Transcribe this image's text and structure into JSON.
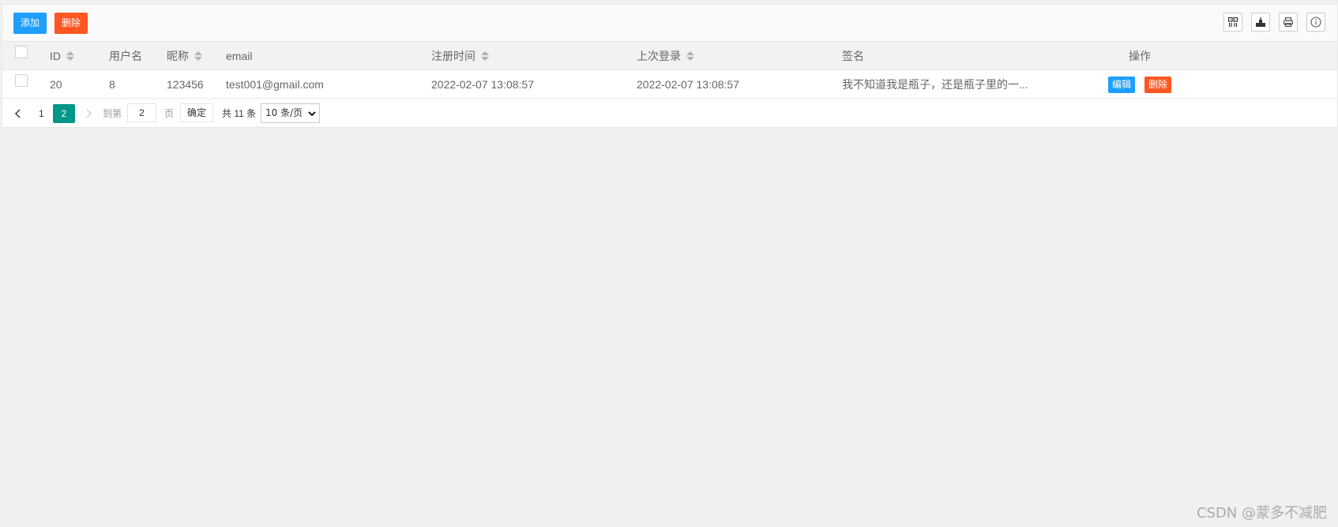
{
  "toolbar": {
    "add_label": "添加",
    "delete_label": "删除",
    "add_color": "#1e9fff",
    "delete_color": "#ff5722",
    "icons": [
      "columns-icon",
      "export-icon",
      "print-icon",
      "info-icon"
    ]
  },
  "table": {
    "headers": {
      "id": "ID",
      "username": "用户名",
      "nickname": "昵称",
      "email": "email",
      "register_time": "注册时间",
      "last_login": "上次登录",
      "signature": "签名",
      "actions": "操作"
    },
    "rows": [
      {
        "id": "20",
        "username": "8",
        "nickname": "123456",
        "email": "test001@gmail.com",
        "register_time": "2022-02-07 13:08:57",
        "last_login": "2022-02-07 13:08:57",
        "signature": "我不知道我是瓶子，还是瓶子里的一...",
        "edit_label": "编辑",
        "delete_label": "删除"
      }
    ]
  },
  "pagination": {
    "pages": [
      "1",
      "2"
    ],
    "current_page": "2",
    "goto_prefix": "到第",
    "goto_value": "2",
    "goto_suffix": "页",
    "confirm_label": "确定",
    "total_label": "共 11 条",
    "page_size_selected": "10 条/页",
    "accent_color": "#009688"
  },
  "watermark": "CSDN @蒙多不减肥"
}
